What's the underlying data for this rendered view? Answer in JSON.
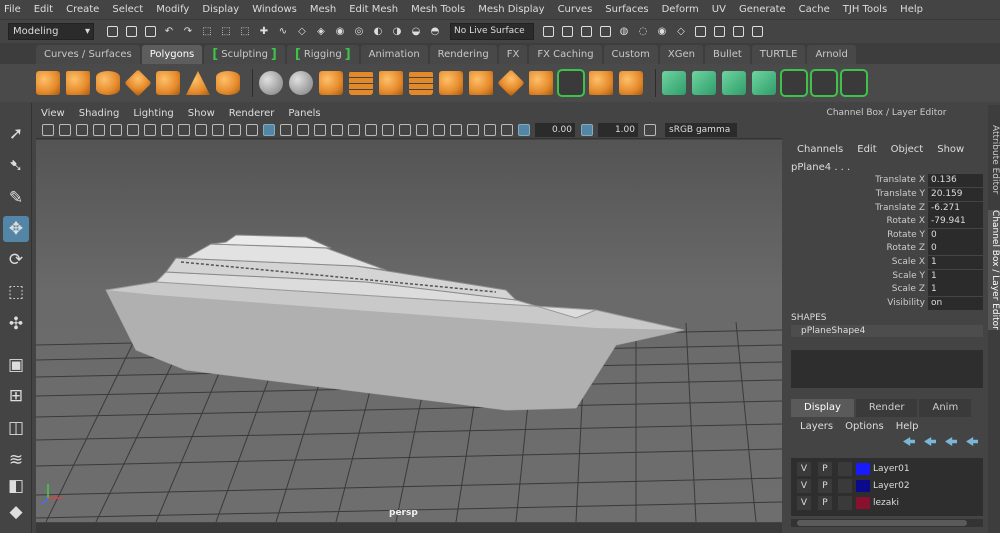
{
  "menubar": [
    "File",
    "Edit",
    "Create",
    "Select",
    "Modify",
    "Display",
    "Windows",
    "Mesh",
    "Edit Mesh",
    "Mesh Tools",
    "Mesh Display",
    "Curves",
    "Surfaces",
    "Deform",
    "UV",
    "Generate",
    "Cache",
    "TJH Tools",
    "Help"
  ],
  "status": {
    "mode": "Modeling",
    "live_surface": "No Live Surface"
  },
  "shelf_tabs": [
    "Curves / Surfaces",
    "Polygons",
    "Sculpting",
    "Rigging",
    "Animation",
    "Rendering",
    "FX",
    "FX Caching",
    "Custom",
    "XGen",
    "Bullet",
    "TURTLE",
    "Arnold"
  ],
  "shelf_active": "Polygons",
  "viewport": {
    "menu": [
      "View",
      "Shading",
      "Lighting",
      "Show",
      "Renderer",
      "Panels"
    ],
    "exposure": "0.00",
    "gamma": "1.00",
    "colorspace": "sRGB gamma",
    "camera": "persp"
  },
  "channel_box": {
    "title": "Channel Box / Layer Editor",
    "menu": [
      "Channels",
      "Edit",
      "Object",
      "Show"
    ],
    "object": "pPlane4 . . .",
    "attributes": [
      {
        "name": "Translate X",
        "value": "0.136"
      },
      {
        "name": "Translate Y",
        "value": "20.159"
      },
      {
        "name": "Translate Z",
        "value": "-6.271"
      },
      {
        "name": "Rotate X",
        "value": "-79.941"
      },
      {
        "name": "Rotate Y",
        "value": "0"
      },
      {
        "name": "Rotate Z",
        "value": "0"
      },
      {
        "name": "Scale X",
        "value": "1"
      },
      {
        "name": "Scale Y",
        "value": "1"
      },
      {
        "name": "Scale Z",
        "value": "1"
      },
      {
        "name": "Visibility",
        "value": "on"
      }
    ],
    "shapes_header": "SHAPES",
    "shape_name": "pPlaneShape4"
  },
  "layer_editor": {
    "tabs": [
      "Display",
      "Render",
      "Anim"
    ],
    "active_tab": "Display",
    "menu": [
      "Layers",
      "Options",
      "Help"
    ],
    "layers": [
      {
        "v": "V",
        "p": "P",
        "color": "#1a1aff",
        "name": "Layer01"
      },
      {
        "v": "V",
        "p": "P",
        "color": "#0a0a8a",
        "name": "Layer02"
      },
      {
        "v": "V",
        "p": "P",
        "color": "#8a1030",
        "name": "lezaki"
      }
    ]
  },
  "side_tabs": [
    "Attribute Editor",
    "Channel Box / Layer Editor"
  ],
  "colors": {
    "accent": "#5285a6",
    "shelf_bracket": "#3ec24a",
    "shelf_icon": "#e4892a"
  }
}
